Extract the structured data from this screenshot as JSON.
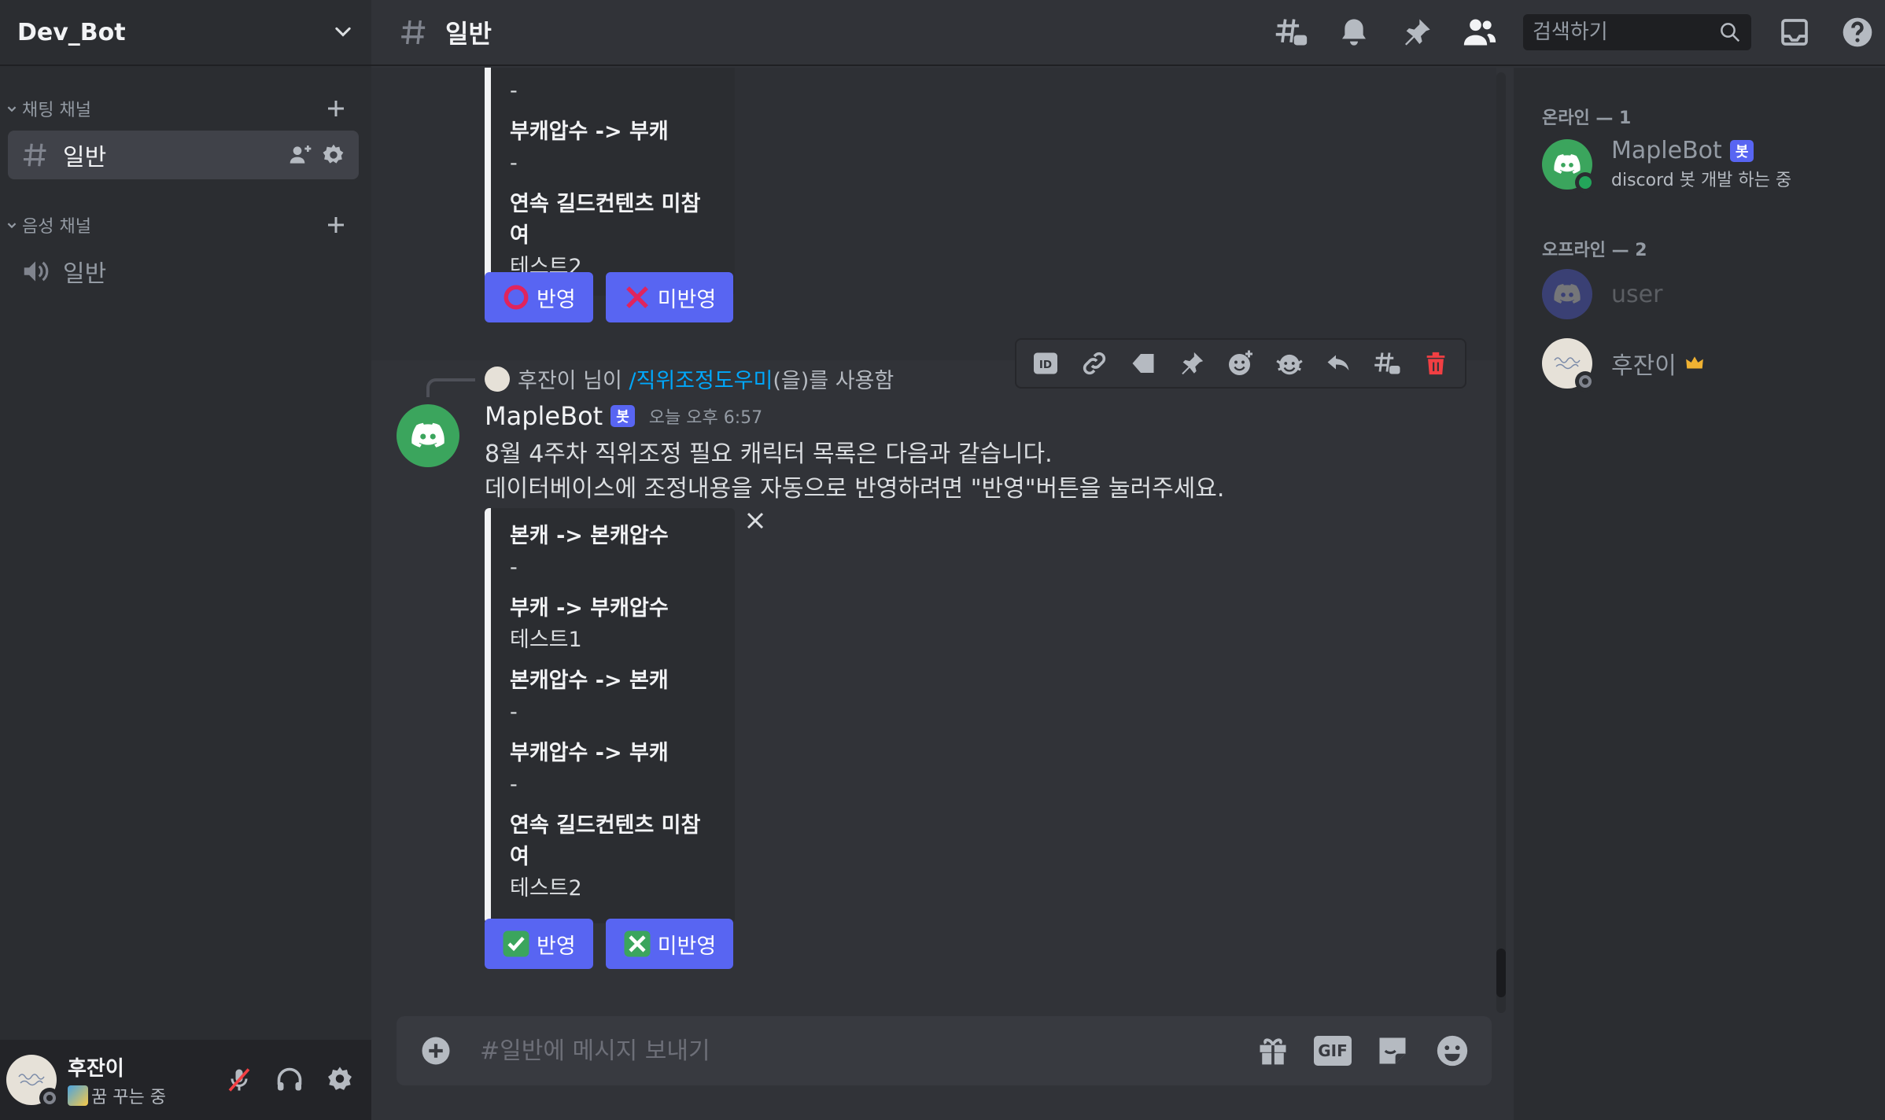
{
  "server": {
    "name": "Dev_Bot"
  },
  "sidebar": {
    "categories": [
      {
        "label": "채팅 채널"
      },
      {
        "label": "음성 채널"
      }
    ],
    "channels": [
      {
        "label": "일반",
        "type": "text",
        "active": true
      },
      {
        "label": "일반",
        "type": "voice",
        "active": false
      }
    ]
  },
  "user_panel": {
    "name": "후잔이",
    "status": "꿈 꾸는 중"
  },
  "topbar": {
    "channel": "일반",
    "search_placeholder": "검색하기"
  },
  "prev_message": {
    "fields": [
      {
        "name": "",
        "value": "-"
      },
      {
        "name": "부캐압수 -> 부캐",
        "value": "-"
      },
      {
        "name": "연속 길드컨텐츠 미참여",
        "value": "테스트2"
      }
    ],
    "buttons": [
      {
        "label": "반영",
        "icon": "red-circle-icon"
      },
      {
        "label": "미반영",
        "icon": "red-x-icon"
      }
    ]
  },
  "message": {
    "interaction_user": "후잔이",
    "interaction_prefix": " 님이 ",
    "interaction_command": "/직위조정도우미",
    "interaction_suffix": "(을)를 사용함",
    "author": "MapleBot",
    "bot_tag": "봇",
    "time": "오늘 오후 6:57",
    "line1": "8월 4주차 직위조정 필요 캐릭터 목록은 다음과 같습니다.",
    "line2": "데이터베이스에 조정내용을 자동으로 반영하려면 \"반영\"버튼을 눌러주세요.",
    "embed_fields": [
      {
        "name": "본캐 -> 본캐압수",
        "value": "-"
      },
      {
        "name": "부캐 -> 부캐압수",
        "value": "테스트1"
      },
      {
        "name": "본캐압수 -> 본캐",
        "value": "-"
      },
      {
        "name": "부캐압수 -> 부캐",
        "value": "-"
      },
      {
        "name": "연속 길드컨텐츠 미참여",
        "value": "테스트2"
      }
    ],
    "buttons": [
      {
        "label": "반영",
        "icon": "green-check-icon"
      },
      {
        "label": "미반영",
        "icon": "green-x-icon"
      }
    ]
  },
  "composer": {
    "placeholder": "#일반에 메시지 보내기",
    "gif_label": "GIF"
  },
  "members": {
    "online_header": "온라인 — 1",
    "offline_header": "오프라인 — 2",
    "online": [
      {
        "name": "MapleBot",
        "tag": "봇",
        "activity": "discord 봇 개발 하는 중"
      }
    ],
    "offline": [
      {
        "name": "user"
      },
      {
        "name": "후잔이"
      }
    ]
  },
  "colors": {
    "blurple": "#5865f2",
    "online": "#23a55a",
    "bot_avatar": "#3ba55d",
    "danger": "#f23f43",
    "link": "#00a8fc"
  }
}
